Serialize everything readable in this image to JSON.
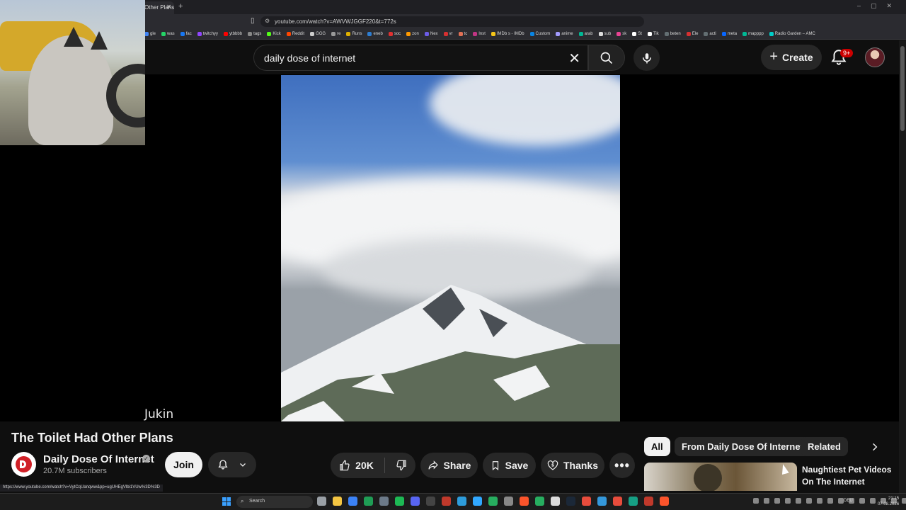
{
  "browser": {
    "tab_title": "Other Plans",
    "tab_close": "✕",
    "new_tab": "+",
    "url": "youtube.com/watch?v=AWVWJGGF220&t=772s",
    "bookmarks": [
      {
        "label": "gle",
        "color": "#4285f4"
      },
      {
        "label": "was",
        "color": "#25d366"
      },
      {
        "label": "fac",
        "color": "#1877f2"
      },
      {
        "label": "twitchyy",
        "color": "#9146ff"
      },
      {
        "label": "ytbbbb",
        "color": "#ff0000"
      },
      {
        "label": "tags",
        "color": "#888888"
      },
      {
        "label": "Kick",
        "color": "#53fc18"
      },
      {
        "label": "Reddit",
        "color": "#ff4500"
      },
      {
        "label": "GGG",
        "color": "#cccccc"
      },
      {
        "label": "re",
        "color": "#999999"
      },
      {
        "label": "Runs",
        "color": "#e0b000"
      },
      {
        "label": "eneb",
        "color": "#2d7dd2"
      },
      {
        "label": "soc",
        "color": "#e03131"
      },
      {
        "label": "zon",
        "color": "#ff9900"
      },
      {
        "label": "Nex",
        "color": "#6c5ce7"
      },
      {
        "label": "vr",
        "color": "#d63031"
      },
      {
        "label": "tc",
        "color": "#e17055"
      },
      {
        "label": "Inst",
        "color": "#c13584"
      },
      {
        "label": "IMDb s - IMDb",
        "color": "#f5c518"
      },
      {
        "label": "Custom",
        "color": "#0984e3"
      },
      {
        "label": "anime",
        "color": "#a29bfe"
      },
      {
        "label": "arab",
        "color": "#00b894"
      },
      {
        "label": "sub",
        "color": "#dddddd"
      },
      {
        "label": "sk",
        "color": "#e84393"
      },
      {
        "label": "St",
        "color": "#ffffff"
      },
      {
        "label": "Tik",
        "color": "#ffffff"
      },
      {
        "label": "beten",
        "color": "#636e72"
      },
      {
        "label": "Ele",
        "color": "#d63031"
      },
      {
        "label": "acti",
        "color": "#636e72"
      },
      {
        "label": "meta",
        "color": "#0866ff"
      },
      {
        "label": "mapppp",
        "color": "#00b894"
      },
      {
        "label": "Radio Garden – AMC",
        "color": "#00cec9"
      }
    ]
  },
  "header": {
    "search_query": "daily dose of internet",
    "create_label": "Create",
    "notif_badge": "9+"
  },
  "player": {
    "watermark": "Jukin"
  },
  "video": {
    "title": "The Toilet Had Other Plans",
    "channel_name": "Daily Dose Of Internet",
    "subscribers": "20.7M subscribers",
    "join_label": "Join",
    "likes": "20K",
    "share_label": "Share",
    "save_label": "Save",
    "thanks_label": "Thanks"
  },
  "chips": {
    "all": "All",
    "from_channel": "From Daily Dose Of Internet",
    "related": "Related"
  },
  "recommendation": {
    "title": "Naughtiest Pet Videos On The Internet"
  },
  "status_url": "https://www.youtube.com/watch?v=VytCqUanqww&pp=ugUHEgVlbi1VUw%3D%3D",
  "taskbar": {
    "search_placeholder": "Search",
    "language": "DEU",
    "time": "21:15",
    "date": "07.08.2026"
  }
}
